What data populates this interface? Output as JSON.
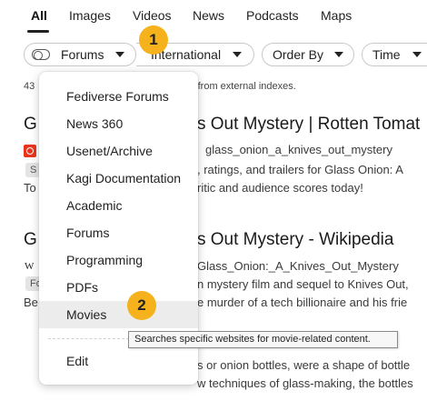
{
  "nav": {
    "tabs": [
      {
        "label": "All",
        "active": true
      },
      {
        "label": "Images"
      },
      {
        "label": "Videos"
      },
      {
        "label": "News"
      },
      {
        "label": "Podcasts"
      },
      {
        "label": "Maps"
      }
    ]
  },
  "filters": {
    "lens": "Forums",
    "region": "International",
    "order": "Order By",
    "time": "Time"
  },
  "results_info": {
    "count": "43",
    "tail": "ts from external indexes."
  },
  "results": [
    {
      "title_left": "G",
      "title_right": "s Out Mystery | Rotten Tomat",
      "url_tail": "glass_onion_a_knives_out_mystery",
      "chip": "S",
      "line1_right": ", ratings, and trailers for Glass Onion: A",
      "line2_left": "To",
      "line2_right": "ritic and audience scores today!"
    },
    {
      "title_left": "G",
      "title_right": "s Out Mystery - Wikipedia",
      "favicon_letter": "W",
      "url_tail": "Glass_Onion:_A_Knives_Out_Mystery",
      "chip": "Fo",
      "line1_right": "n mystery film and sequel to Knives Out,",
      "line2_left": "Be",
      "line2_right": "e murder of a tech billionaire and his frie"
    }
  ],
  "snippet_bottom": {
    "line1": "s or onion bottles, were a shape of bottle",
    "line2": "w techniques of glass-making, the bottles"
  },
  "menu": {
    "items": [
      "Fediverse Forums",
      "News 360",
      "Usenet/Archive",
      "Kagi Documentation",
      "Academic",
      "Forums",
      "Programming",
      "PDFs",
      "Movies"
    ],
    "edit": "Edit"
  },
  "tooltip": "Searches specific websites for movie-related content.",
  "badges": [
    "1",
    "2"
  ],
  "colors": {
    "badge": "#f5b21c",
    "hover": "#ececec",
    "rt_favicon": "#e8341c"
  }
}
